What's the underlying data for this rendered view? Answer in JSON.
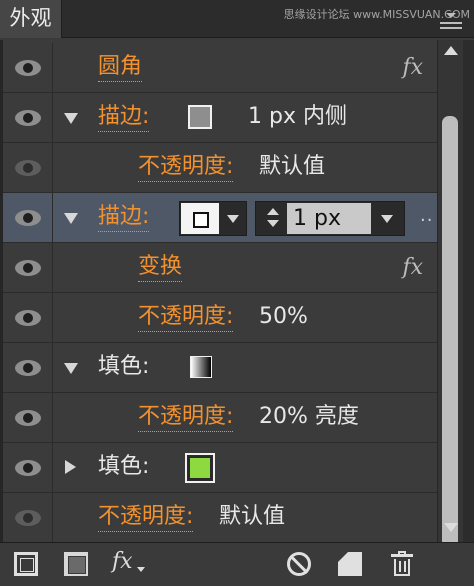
{
  "panel": {
    "tab_label": "外观",
    "watermark": "思缘设计论坛 www.MISSVUAN.COM"
  },
  "rows": [
    {
      "name": "圆角",
      "fx": "fx"
    },
    {
      "name": "描边:",
      "value": "1 px  内侧"
    },
    {
      "name": "不透明度:",
      "value": "默认值"
    },
    {
      "name": "描边:",
      "stroke_weight": "1 px",
      "more": ".."
    },
    {
      "name": "变换",
      "fx": "fx"
    },
    {
      "name": "不透明度:",
      "value": "50%"
    },
    {
      "name": "填色:"
    },
    {
      "name": "不透明度:",
      "value": "20% 亮度"
    },
    {
      "name": "填色:",
      "swatch_color": "#8ed93f"
    },
    {
      "name": "不透明度:",
      "value": "默认值"
    }
  ],
  "bottom_toolbar": {
    "fx_label": "fx"
  },
  "colors": {
    "accent_orange": "#f2912e",
    "selected_row": "#4f5867",
    "fill_green": "#8ed93f"
  }
}
